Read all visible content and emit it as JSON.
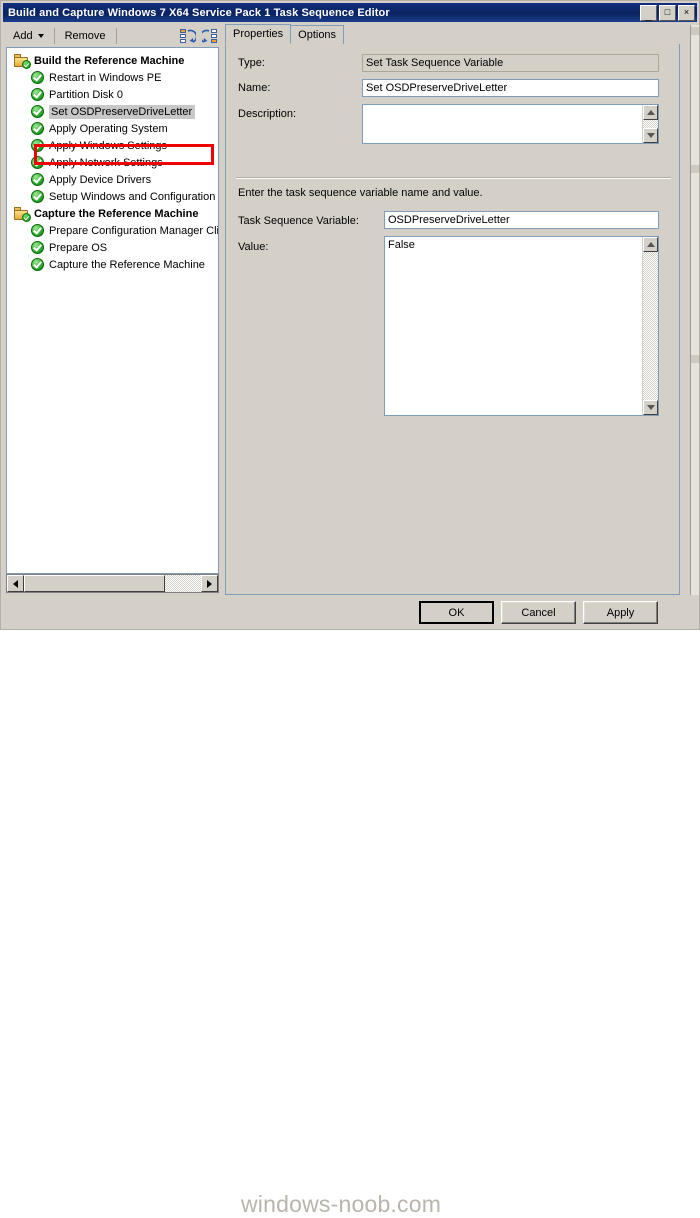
{
  "window": {
    "title": "Build and Capture Windows 7 X64 Service Pack 1 Task Sequence Editor",
    "minimize_label": "_",
    "maximize_label": "□",
    "close_label": "×"
  },
  "toolbar": {
    "add_label": "Add",
    "remove_label": "Remove",
    "icon1_name": "collapse-all-icon",
    "icon2_name": "expand-all-icon"
  },
  "tree": {
    "items": [
      {
        "label": "Build the Reference Machine",
        "type": "group",
        "selected": false
      },
      {
        "label": "Restart in Windows PE",
        "type": "step",
        "selected": false
      },
      {
        "label": "Partition Disk 0",
        "type": "step",
        "selected": false
      },
      {
        "label": "Set OSDPreserveDriveLetter",
        "type": "step",
        "selected": true
      },
      {
        "label": "Apply Operating System",
        "type": "step",
        "selected": false
      },
      {
        "label": "Apply Windows Settings",
        "type": "step",
        "selected": false
      },
      {
        "label": "Apply Network Settings",
        "type": "step",
        "selected": false
      },
      {
        "label": "Apply Device Drivers",
        "type": "step",
        "selected": false
      },
      {
        "label": "Setup Windows and Configuration",
        "type": "step",
        "selected": false
      },
      {
        "label": "Capture the Reference Machine",
        "type": "group",
        "selected": false
      },
      {
        "label": "Prepare Configuration Manager Cli",
        "type": "step",
        "selected": false
      },
      {
        "label": "Prepare OS",
        "type": "step",
        "selected": false
      },
      {
        "label": "Capture the Reference Machine",
        "type": "step",
        "selected": false
      }
    ]
  },
  "tabs": [
    {
      "label": "Properties",
      "active": true
    },
    {
      "label": "Options",
      "active": false
    }
  ],
  "properties": {
    "type_label": "Type:",
    "type_value": "Set Task Sequence Variable",
    "name_label": "Name:",
    "name_value": "Set OSDPreserveDriveLetter",
    "description_label": "Description:",
    "description_value": "",
    "instruction": "Enter the task sequence variable name and value.",
    "variable_label": "Task Sequence Variable:",
    "variable_value": "OSDPreserveDriveLetter",
    "value_label": "Value:",
    "value_value": "False"
  },
  "buttons": {
    "ok": "OK",
    "cancel": "Cancel",
    "apply": "Apply"
  },
  "watermark": "windows-noob.com",
  "colors": {
    "titlebar": "#0a2260",
    "window_face": "#d4d0c8",
    "annotation": "#ee0000",
    "field_border": "#7f9db9",
    "check_green": "#18a018"
  }
}
